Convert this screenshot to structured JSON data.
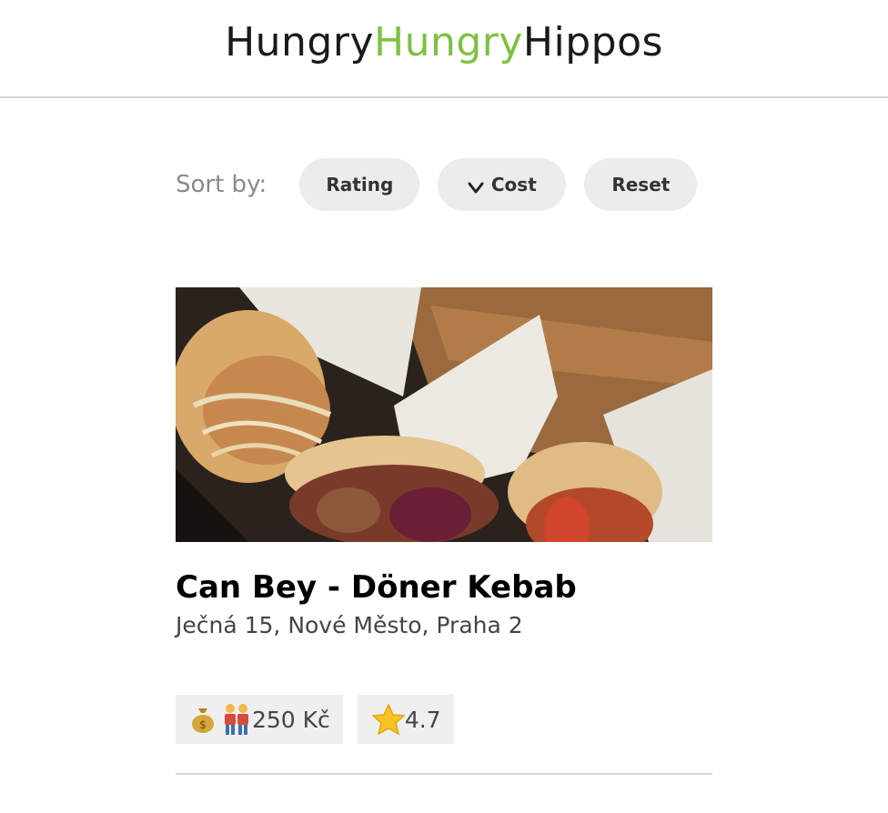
{
  "header": {
    "logo_part1": "Hungry",
    "logo_part2": "Hungry",
    "logo_part3": "Hippos",
    "accent_color": "#7dc142"
  },
  "sort": {
    "label": "Sort by:",
    "buttons": [
      {
        "label": "Rating"
      },
      {
        "label": "Cost",
        "icon": "chevron-down-icon"
      },
      {
        "label": "Reset"
      }
    ]
  },
  "restaurant": {
    "name": "Can Bey - Döner Kebab",
    "address": "Ječná 15, Nové Město, Praha 2",
    "cost": "250 Kč",
    "rating": "4.7",
    "cost_icons": [
      "money-bag-icon",
      "two-people-icon"
    ],
    "rating_icon": "star-icon",
    "image": "kebab-photo"
  }
}
